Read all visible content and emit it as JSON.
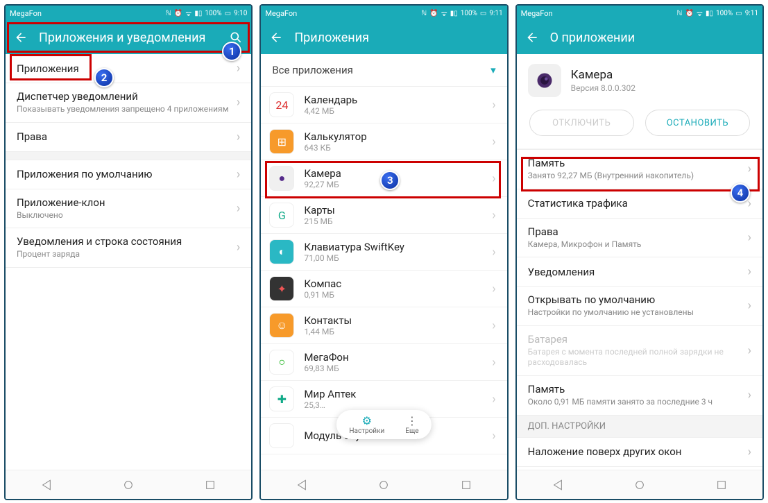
{
  "status": {
    "carrier": "MegaFon",
    "battery": "100%",
    "time1": "9:10",
    "time2": "9:11",
    "time3": "9:11"
  },
  "screen1": {
    "header": "Приложения и уведомления",
    "items": [
      {
        "title": "Приложения",
        "sub": ""
      },
      {
        "title": "Диспетчер уведомлений",
        "sub": "Показывать уведомления запрещено 4 приложениям"
      },
      {
        "title": "Права",
        "sub": ""
      },
      {
        "title": "Приложения по умолчанию",
        "sub": ""
      },
      {
        "title": "Приложение-клон",
        "sub": "Выключено"
      },
      {
        "title": "Уведомления и строка состояния",
        "sub": "Процент заряда"
      }
    ]
  },
  "screen2": {
    "header": "Приложения",
    "filter": "Все приложения",
    "apps": [
      {
        "name": "Календарь",
        "size": "4,42 МБ",
        "icon_bg": "#fff",
        "icon_text": "24",
        "icon_color": "#d33"
      },
      {
        "name": "Калькулятор",
        "size": "643 КБ",
        "icon_bg": "#f79a2a",
        "icon_text": "⊞",
        "icon_color": "#fff"
      },
      {
        "name": "Камера",
        "size": "92,27 МБ",
        "icon_bg": "#f0f0f0",
        "icon_text": "●",
        "icon_color": "#552a8a"
      },
      {
        "name": "Карты",
        "size": "215 МБ",
        "icon_bg": "#fff",
        "icon_text": "G",
        "icon_color": "#1a8"
      },
      {
        "name": "Клавиатура SwiftKey",
        "size": "71,00 МБ",
        "icon_bg": "#2ab8c4",
        "icon_text": "◐",
        "icon_color": "#fff"
      },
      {
        "name": "Компас",
        "size": "0,91 МБ",
        "icon_bg": "#333",
        "icon_text": "✦",
        "icon_color": "#e55"
      },
      {
        "name": "Контакты",
        "size": "1,44 МБ",
        "icon_bg": "#f79a2a",
        "icon_text": "☺",
        "icon_color": "#fff"
      },
      {
        "name": "МегаФон",
        "size": "69,83 МБ",
        "icon_bg": "#fff",
        "icon_text": "○",
        "icon_color": "#0a0"
      },
      {
        "name": "Мир Аптек",
        "size": "25,3…",
        "icon_bg": "#fff",
        "icon_text": "✚",
        "icon_color": "#1a8"
      },
      {
        "name": "Модуль службы печати",
        "size": "",
        "icon_bg": "#fff",
        "icon_text": "",
        "icon_color": ""
      }
    ],
    "menu": {
      "settings": "Настройки",
      "more": "Еще"
    }
  },
  "screen3": {
    "header": "О приложении",
    "app": {
      "name": "Камера",
      "version": "Версия 8.0.0.302"
    },
    "btn_disable": "ОТКЛЮЧИТЬ",
    "btn_stop": "ОСТАНОВИТЬ",
    "rows": [
      {
        "title": "Память",
        "sub": "Занято 92,27 МБ (Внутренний накопитель)"
      },
      {
        "title": "Статистика трафика",
        "sub": ""
      },
      {
        "title": "Права",
        "sub": "Камера, Микрофон и Память"
      },
      {
        "title": "Уведомления",
        "sub": ""
      },
      {
        "title": "Открывать по умолчанию",
        "sub": "Настройки по умолчанию не установлены"
      },
      {
        "title": "Батарея",
        "sub": "Батарея с момента последней полной зарядки не расходовалась",
        "disabled": true
      },
      {
        "title": "Память",
        "sub": "Около 0,91 МБ памяти занято за последние 3 ч"
      }
    ],
    "section": "ДОП. НАСТРОЙКИ",
    "extra": "Наложение поверх других окон"
  },
  "badges": {
    "b1": "1",
    "b2": "2",
    "b3": "3",
    "b4": "4"
  }
}
